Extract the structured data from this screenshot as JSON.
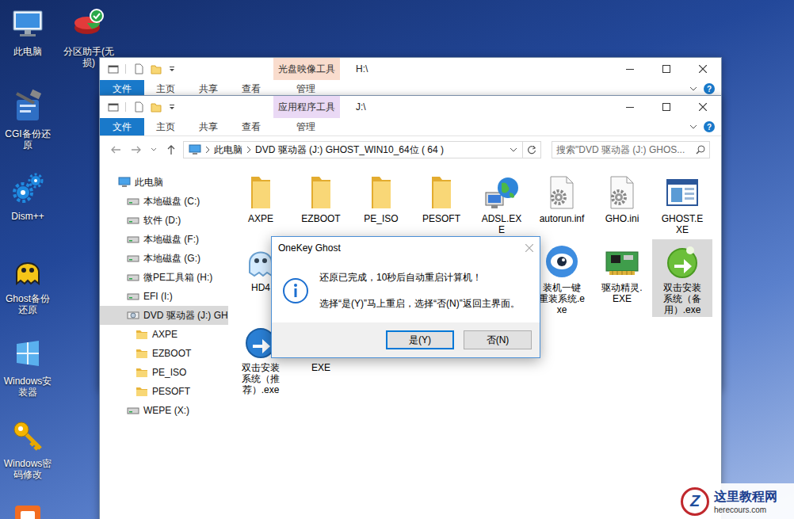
{
  "desktop": {
    "columns": [
      [
        {
          "label": "此电脑",
          "kind": "pc"
        },
        {
          "label": "CGI备份还原",
          "kind": "cgi"
        },
        {
          "label": "Dism++",
          "kind": "dism"
        },
        {
          "label": "Ghost备份还原",
          "kind": "ghost"
        },
        {
          "label": "Windows安装器",
          "kind": "installer"
        },
        {
          "label": "Windows密码修改",
          "kind": "key"
        },
        {
          "label": "",
          "kind": "orange"
        }
      ],
      [
        {
          "label": "分区助手(无损)",
          "kind": "partition"
        }
      ]
    ]
  },
  "back_window": {
    "title": "H:\\",
    "context_group": {
      "label": "光盘映像工具",
      "color": "#f9dccd"
    },
    "tabs": [
      {
        "label": "文件",
        "kind": "file"
      },
      {
        "label": "主页",
        "kind": "tab"
      },
      {
        "label": "共享",
        "kind": "tab"
      },
      {
        "label": "查看",
        "kind": "tab"
      },
      {
        "label": "管理",
        "kind": "context"
      }
    ],
    "help": "?"
  },
  "front_window": {
    "title": "J:\\",
    "context_group": {
      "label": "应用程序工具",
      "color": "#ead9f5"
    },
    "tabs": [
      {
        "label": "文件",
        "kind": "file"
      },
      {
        "label": "主页",
        "kind": "tab"
      },
      {
        "label": "共享",
        "kind": "tab"
      },
      {
        "label": "查看",
        "kind": "tab"
      },
      {
        "label": "管理",
        "kind": "context"
      }
    ],
    "help": "?",
    "address": {
      "segments": [
        "此电脑",
        "DVD 驱动器 (J:) GHOST_WIN10_64位 ( 64 )"
      ]
    },
    "search": {
      "placeholder": "搜索\"DVD 驱动器 (J:) GHOS..."
    },
    "nav": [
      {
        "label": "此电脑",
        "kind": "pc",
        "depth": 0,
        "selected": false
      },
      {
        "label": "本地磁盘 (C:)",
        "kind": "drive",
        "depth": 1,
        "selected": false
      },
      {
        "label": "软件 (D:)",
        "kind": "drive",
        "depth": 1,
        "selected": false
      },
      {
        "label": "本地磁盘 (F:)",
        "kind": "drive",
        "depth": 1,
        "selected": false
      },
      {
        "label": "本地磁盘 (G:)",
        "kind": "drive",
        "depth": 1,
        "selected": false
      },
      {
        "label": "微PE工具箱 (H:)",
        "kind": "drive",
        "depth": 1,
        "selected": false
      },
      {
        "label": "EFI (I:)",
        "kind": "drive",
        "depth": 1,
        "selected": false
      },
      {
        "label": "DVD 驱动器 (J:) GH",
        "kind": "dvd",
        "depth": 1,
        "selected": true
      },
      {
        "label": "AXPE",
        "kind": "folder",
        "depth": 2,
        "selected": false
      },
      {
        "label": "EZBOOT",
        "kind": "folder",
        "depth": 2,
        "selected": false
      },
      {
        "label": "PE_ISO",
        "kind": "folder",
        "depth": 2,
        "selected": false
      },
      {
        "label": "PESOFT",
        "kind": "folder",
        "depth": 2,
        "selected": false
      },
      {
        "label": "WEPE (X:)",
        "kind": "drive",
        "depth": 1,
        "selected": false
      }
    ],
    "files": [
      [
        {
          "label": "AXPE",
          "kind": "folder",
          "selected": false
        },
        {
          "label": "EZBOOT",
          "kind": "folder",
          "selected": false
        },
        {
          "label": "PE_ISO",
          "kind": "folder",
          "selected": false
        },
        {
          "label": "PESOFT",
          "kind": "folder",
          "selected": false
        },
        {
          "label": "ADSL.EXE",
          "kind": "network",
          "selected": false
        },
        {
          "label": "autorun.inf",
          "kind": "config",
          "selected": false
        },
        {
          "label": "GHO.ini",
          "kind": "config",
          "selected": false
        },
        {
          "label": "GHOST.EXE",
          "kind": "window",
          "selected": false
        }
      ],
      [
        {
          "label": "HD4",
          "kind": "ghost",
          "selected": false
        },
        null,
        null,
        null,
        null,
        {
          "label": "装机一键重装系统.exe",
          "kind": "eye",
          "selected": false
        },
        {
          "label": "驱动精灵.EXE",
          "kind": "card",
          "selected": false
        },
        {
          "label": "双击安装系统（备用）.exe",
          "kind": "install-green",
          "selected": true
        }
      ],
      [
        {
          "label": "双击安装系统（推荐）.exe",
          "kind": "install-blue",
          "selected": false
        },
        {
          "label": "EXE",
          "kind": "exe",
          "selected": false
        }
      ]
    ]
  },
  "dialog": {
    "title": "OneKey Ghost",
    "lines": [
      "还原已完成，10秒后自动重启计算机！",
      "选择“是(Y)”马上重启，选择“否(N)”返回主界面。"
    ],
    "buttons": [
      {
        "label": "是(Y)",
        "default": true
      },
      {
        "label": "否(N)",
        "default": false
      }
    ]
  },
  "watermark": {
    "mark": "Z",
    "title": "这里教程网",
    "url": "herecours.com"
  }
}
